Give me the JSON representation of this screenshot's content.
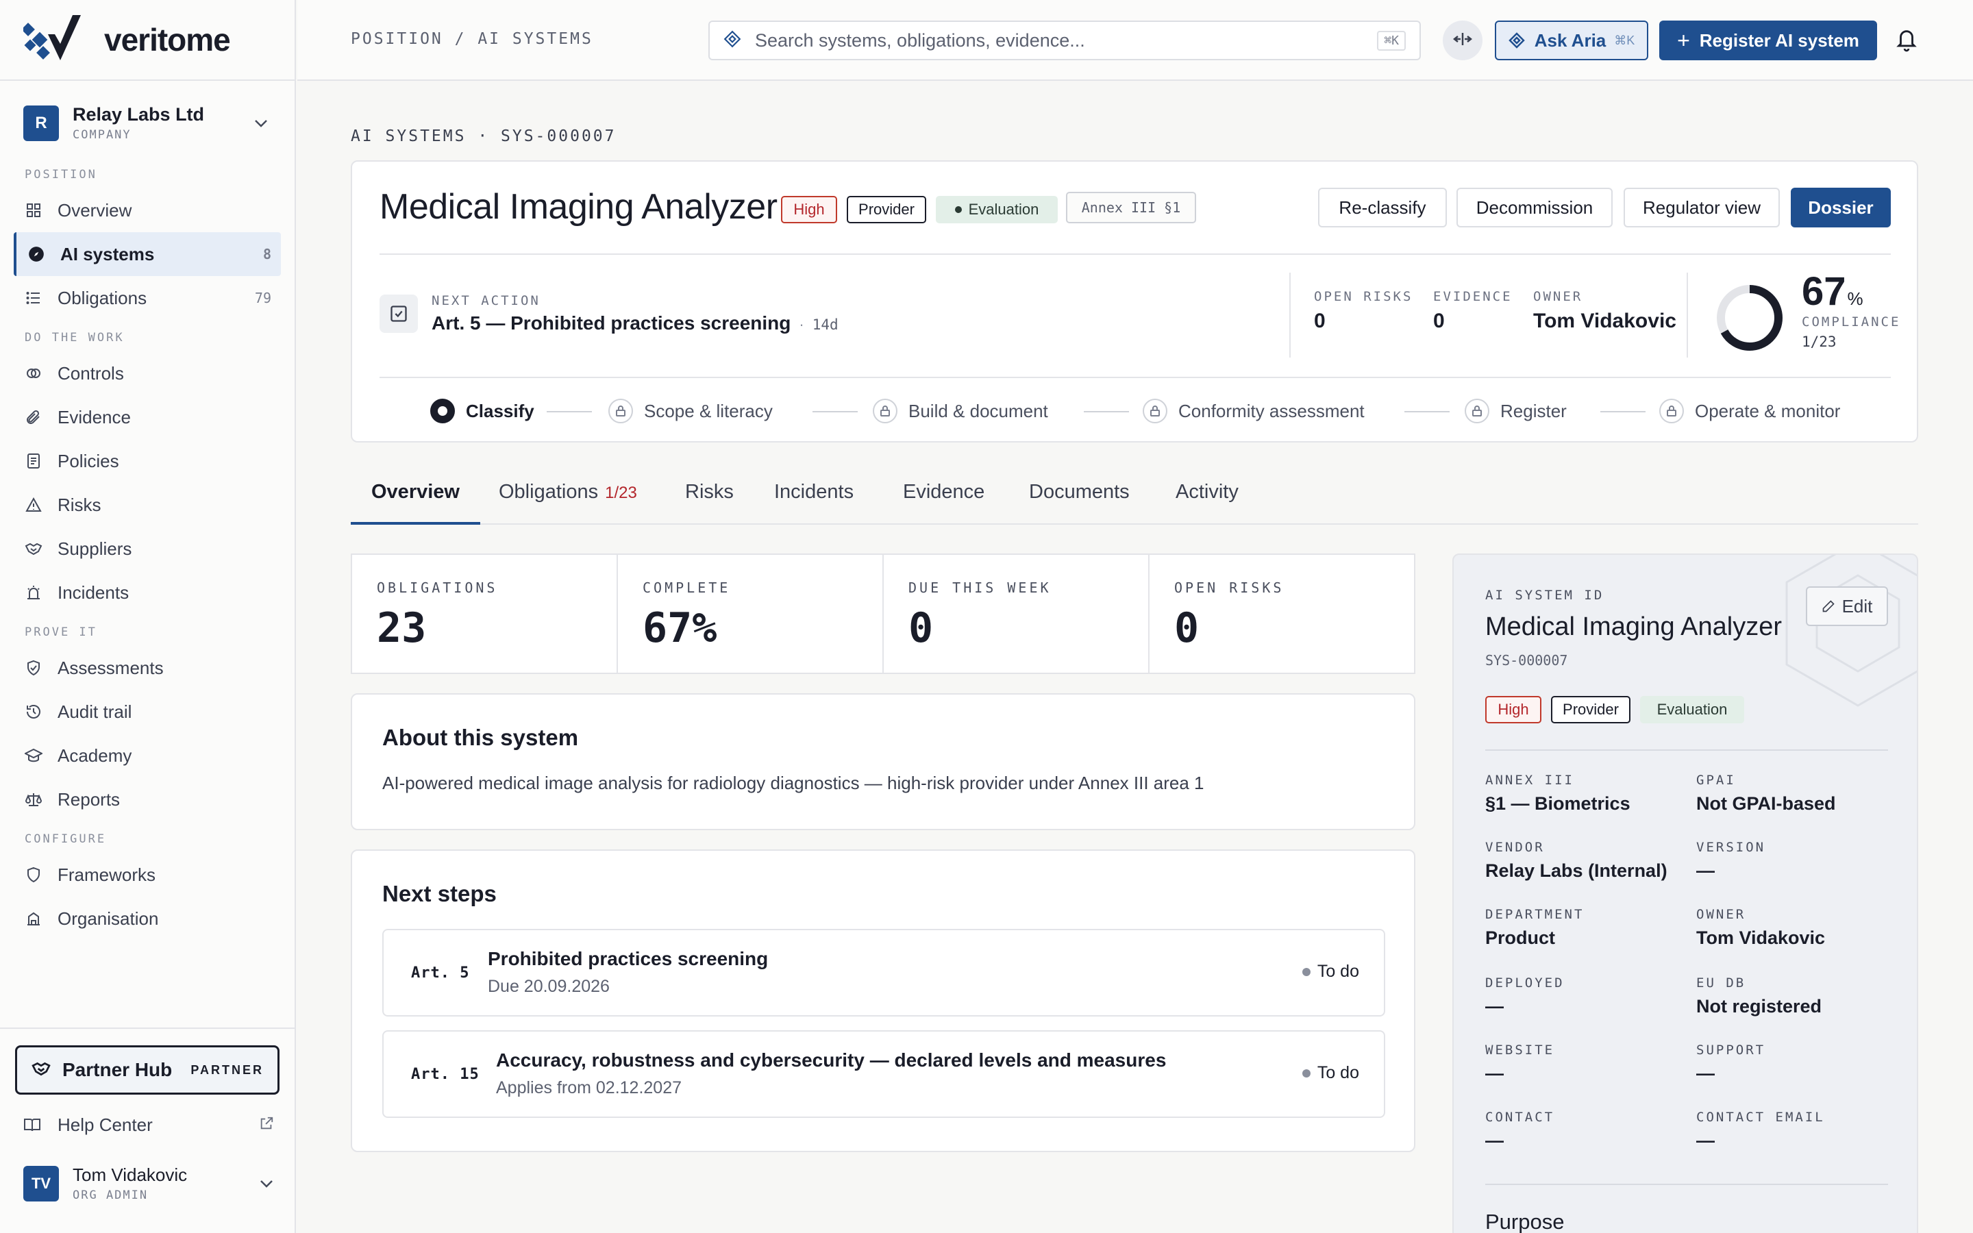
{
  "app": {
    "logo_text": "veritome"
  },
  "org": {
    "initial": "R",
    "name": "Relay Labs Ltd",
    "type": "COMPANY"
  },
  "sidebar": {
    "sections": {
      "position": "POSITION",
      "work": "DO THE WORK",
      "prove": "PROVE IT",
      "configure": "CONFIGURE"
    },
    "items": [
      {
        "label": "Overview",
        "icon": "grid-icon"
      },
      {
        "label": "AI systems",
        "count": "8",
        "icon": "compass-icon"
      },
      {
        "label": "Obligations",
        "count": "79",
        "icon": "list-icon"
      },
      {
        "label": "Controls",
        "icon": "controls-icon"
      },
      {
        "label": "Evidence",
        "icon": "paperclip-icon"
      },
      {
        "label": "Policies",
        "icon": "document-icon"
      },
      {
        "label": "Risks",
        "icon": "warning-icon"
      },
      {
        "label": "Suppliers",
        "icon": "handshake-icon"
      },
      {
        "label": "Incidents",
        "icon": "siren-icon"
      },
      {
        "label": "Assessments",
        "icon": "shield-check-icon"
      },
      {
        "label": "Audit trail",
        "icon": "history-icon"
      },
      {
        "label": "Academy",
        "icon": "graduation-icon"
      },
      {
        "label": "Reports",
        "icon": "scale-icon"
      },
      {
        "label": "Frameworks",
        "icon": "shield-icon"
      },
      {
        "label": "Organisation",
        "icon": "building-icon"
      }
    ],
    "partner": {
      "label": "Partner Hub",
      "badge": "PARTNER"
    },
    "help": "Help Center",
    "user": {
      "initials": "TV",
      "name": "Tom Vidakovic",
      "role": "ORG ADMIN"
    }
  },
  "topbar": {
    "breadcrumb": "POSITION / AI SYSTEMS",
    "search_placeholder": "Search systems, obligations, evidence...",
    "search_kbd": "⌘K",
    "aria_label": "Ask Aria",
    "aria_kbd": "⌘K",
    "register_label": "Register AI system"
  },
  "system": {
    "crumb": "AI SYSTEMS · SYS-000007",
    "name": "Medical Imaging Analyzer",
    "tags": {
      "risk": "High",
      "role": "Provider",
      "stage": "Evaluation",
      "annex": "Annex III §1"
    },
    "actions": {
      "reclassify": "Re-classify",
      "decommission": "Decommission",
      "regulator": "Regulator view",
      "dossier": "Dossier"
    },
    "next_action": {
      "label": "NEXT ACTION",
      "value": "Art. 5 — Prohibited practices screening",
      "due": "14d"
    },
    "meta": {
      "open_risks_label": "OPEN RISKS",
      "open_risks": "0",
      "evidence_label": "EVIDENCE",
      "evidence": "0",
      "owner_label": "OWNER",
      "owner": "Tom Vidakovic"
    },
    "compliance": {
      "value": "67",
      "unit": "%",
      "label": "COMPLIANCE",
      "fraction": "1/23",
      "percent": 67
    },
    "steps": [
      "Classify",
      "Scope & literacy",
      "Build & document",
      "Conformity assessment",
      "Register",
      "Operate & monitor"
    ]
  },
  "tabs": [
    {
      "label": "Overview"
    },
    {
      "label": "Obligations",
      "sub": "1/23"
    },
    {
      "label": "Risks"
    },
    {
      "label": "Incidents"
    },
    {
      "label": "Evidence"
    },
    {
      "label": "Documents"
    },
    {
      "label": "Activity"
    }
  ],
  "stats": [
    {
      "label": "OBLIGATIONS",
      "value": "23"
    },
    {
      "label": "COMPLETE",
      "value": "67%"
    },
    {
      "label": "DUE THIS WEEK",
      "value": "0"
    },
    {
      "label": "OPEN RISKS",
      "value": "0"
    }
  ],
  "about": {
    "title": "About this system",
    "text": "AI-powered medical image analysis for radiology diagnostics — high-risk provider under Annex III area 1"
  },
  "next_steps": {
    "title": "Next steps",
    "items": [
      {
        "art": "Art. 5",
        "title": "Prohibited practices screening",
        "date": "Due 20.09.2026",
        "status": "To do"
      },
      {
        "art": "Art. 15",
        "title": "Accuracy, robustness and cybersecurity — declared levels and measures",
        "date": "Applies from 02.12.2027",
        "status": "To do"
      }
    ]
  },
  "panel": {
    "id_label": "AI SYSTEM ID",
    "name": "Medical Imaging Analyzer",
    "id": "SYS-000007",
    "edit": "Edit",
    "fields": [
      {
        "label": "ANNEX III",
        "value": "§1 — Biometrics"
      },
      {
        "label": "GPAI",
        "value": "Not GPAI-based"
      },
      {
        "label": "VENDOR",
        "value": "Relay Labs (Internal)"
      },
      {
        "label": "VERSION",
        "value": "—"
      },
      {
        "label": "DEPARTMENT",
        "value": "Product"
      },
      {
        "label": "OWNER",
        "value": "Tom Vidakovic"
      },
      {
        "label": "DEPLOYED",
        "value": "—"
      },
      {
        "label": "EU DB",
        "value": "Not registered"
      },
      {
        "label": "WEBSITE",
        "value": "—"
      },
      {
        "label": "SUPPORT",
        "value": "—"
      },
      {
        "label": "CONTACT",
        "value": "—"
      },
      {
        "label": "CONTACT EMAIL",
        "value": "—"
      }
    ],
    "purpose": "Purpose"
  },
  "colors": {
    "primary": "#1f4f8f",
    "high": "#b3262b",
    "evaluation_bg": "#e3efe8"
  }
}
